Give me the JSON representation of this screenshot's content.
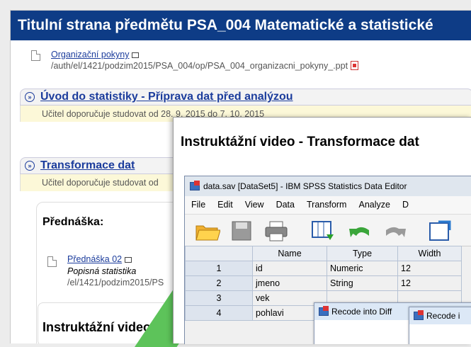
{
  "header": {
    "title": "Titulní strana předmětu PSA_004 Matematické a statistické"
  },
  "doc_item": {
    "link": "Organizační pokyny",
    "path": "/auth/el/1421/podzim2015/PSA_004/op/PSA_004_organizacni_pokyny_.ppt"
  },
  "section1": {
    "title": "Úvod do statistiky - Příprava dat před analýzou",
    "note": "Učitel doporučuje studovat od 28. 9. 2015 do 7. 10. 2015"
  },
  "section2": {
    "title": "Transformace dat",
    "note": "Učitel doporučuje studovat od",
    "subhead": "Přednáška:",
    "lecture_link": "Přednáška 02",
    "lecture_desc": "Popisná statistika",
    "lecture_path": "/el/1421/podzim2015/PS",
    "video_heading": "Instruktážní video -"
  },
  "popup": {
    "title": "Instruktážní video - Transformace dat",
    "spss_window_title": "data.sav [DataSet5] - IBM SPSS Statistics Data Editor",
    "menu": [
      "File",
      "Edit",
      "View",
      "Data",
      "Transform",
      "Analyze",
      "D"
    ],
    "columns": [
      "",
      "Name",
      "Type",
      "Width"
    ],
    "rows": [
      [
        "1",
        "id",
        "Numeric",
        "12"
      ],
      [
        "2",
        "jmeno",
        "String",
        "12"
      ],
      [
        "3",
        "vek",
        "",
        ""
      ],
      [
        "4",
        "pohlavi",
        "",
        ""
      ]
    ],
    "dialog1_title": "Recode into Diff",
    "dialog2_title": "Recode i"
  },
  "colors": {
    "header": "#0e3c86",
    "link": "#1b3c9c",
    "note_band": "#fcf8d8",
    "green": "#5dc35a"
  }
}
